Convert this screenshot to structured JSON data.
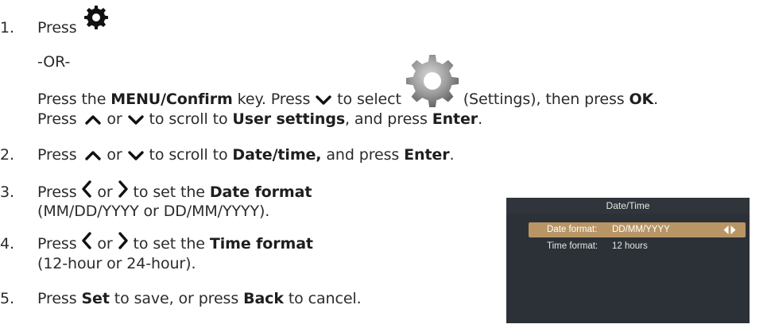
{
  "steps": [
    {
      "number": "1.",
      "press": "Press",
      "or_sep": "-OR-",
      "line2": {
        "a": "Press the ",
        "menu_key": "MENU/Confirm",
        "b": " key. Press ",
        "c": " to select ",
        "d": " (Settings), then press ",
        "ok": "OK",
        "e": "."
      },
      "line3": {
        "a": "Press ",
        "or": " or ",
        "b": " to scroll to ",
        "user_settings": "User settings",
        "c": ", and press ",
        "enter": "Enter",
        "d": "."
      }
    },
    {
      "number": "2.",
      "a": "Press ",
      "or": " or ",
      "b": " to scroll to ",
      "date_time": "Date/time,",
      "c": " and press ",
      "enter": "Enter",
      "d": "."
    },
    {
      "number": "3.",
      "a": "Press ",
      "or": " or ",
      "b": " to  set the ",
      "date_format": "Date format",
      "sub": "(MM/DD/YYYY or DD/MM/YYYY)."
    },
    {
      "number": "4.",
      "a": "Press ",
      "or": " or ",
      "b": " to  set the ",
      "time_format": "Time format",
      "sub": "(12-hour or 24-hour)."
    },
    {
      "number": "5.",
      "a": "Press ",
      "set": "Set",
      "b": " to save, or press ",
      "back": "Back",
      "c": " to cancel."
    }
  ],
  "icons": {
    "settings_small": "gear-icon",
    "settings_large": "gear-icon",
    "up": "chevron-up-icon",
    "down": "chevron-down-icon",
    "left": "chevron-left-icon",
    "right": "chevron-right-icon"
  },
  "screen": {
    "title": "Date/Time",
    "rows": [
      {
        "label": "Date format:",
        "value": "DD/MM/YYYY",
        "selected": true
      },
      {
        "label": "Time format:",
        "value": "12 hours",
        "selected": false
      }
    ]
  },
  "colors": {
    "selected_row": "#b89565",
    "screen_bg": "#2c3137",
    "text": "#2b2b2b"
  }
}
